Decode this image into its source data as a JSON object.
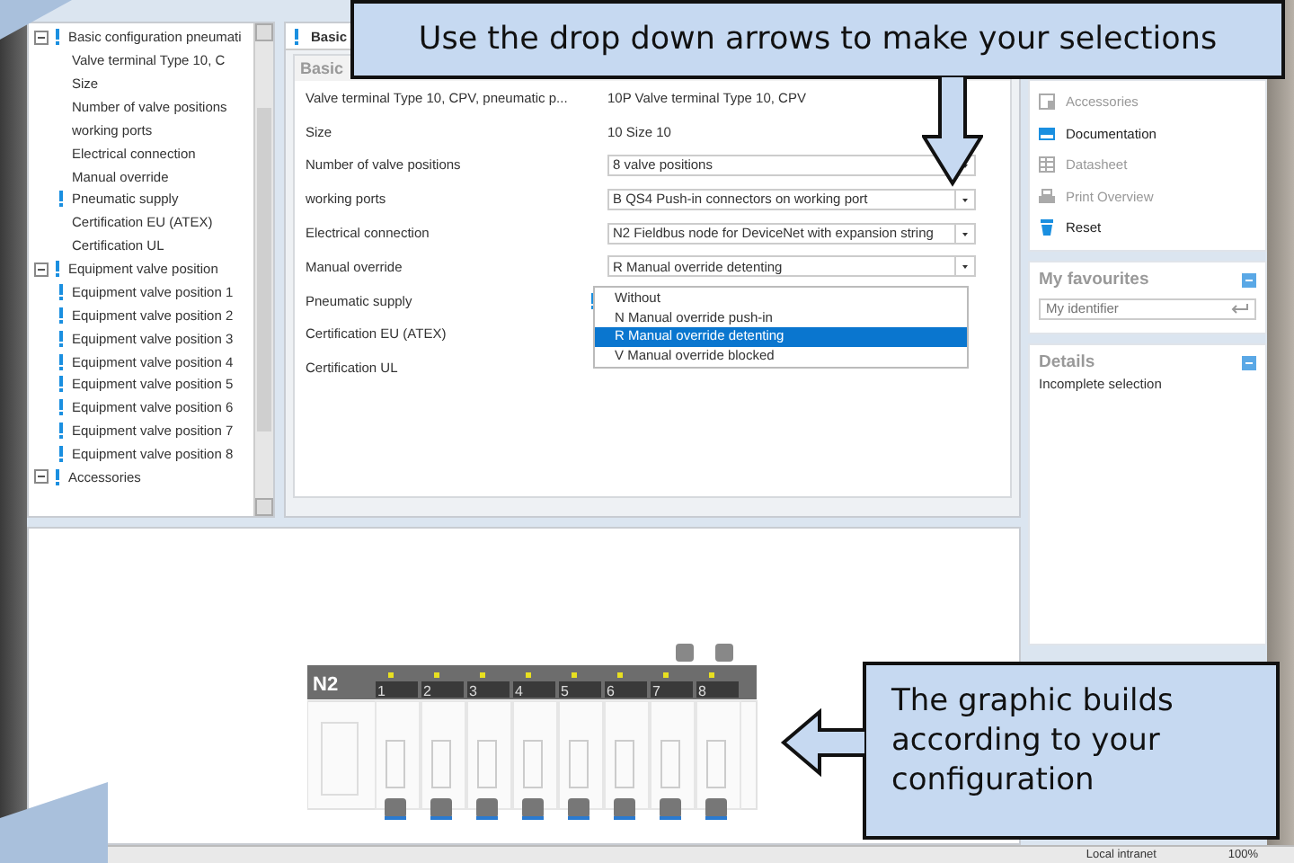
{
  "tree": [
    {
      "label": "Basic configuration pneumati",
      "required": true,
      "expanded": true,
      "children": [
        {
          "label": "Valve terminal Type 10, C",
          "required": false
        },
        {
          "label": "Size",
          "required": false
        },
        {
          "label": "Number of valve positions",
          "required": false
        },
        {
          "label": "working ports",
          "required": false
        },
        {
          "label": "Electrical connection",
          "required": false
        },
        {
          "label": "Manual override",
          "required": false
        },
        {
          "label": "Pneumatic supply",
          "required": true
        },
        {
          "label": "Certification EU (ATEX)",
          "required": false
        },
        {
          "label": "Certification UL",
          "required": false
        }
      ]
    },
    {
      "label": "Equipment valve position",
      "required": true,
      "expanded": true,
      "children": [
        {
          "label": "Equipment valve position 1",
          "required": true
        },
        {
          "label": "Equipment valve position 2",
          "required": true
        },
        {
          "label": "Equipment valve position 3",
          "required": true
        },
        {
          "label": "Equipment valve position 4",
          "required": true
        },
        {
          "label": "Equipment valve position 5",
          "required": true
        },
        {
          "label": "Equipment valve position 6",
          "required": true
        },
        {
          "label": "Equipment valve position 7",
          "required": true
        },
        {
          "label": "Equipment valve position 8",
          "required": true
        }
      ]
    },
    {
      "label": "Accessories",
      "required": true,
      "expanded": true
    }
  ],
  "main": {
    "tab": "Basic",
    "section": "Basic",
    "rows": [
      {
        "label": "Valve terminal Type 10, CPV, pneumatic p...",
        "kind": "text",
        "value": "10P Valve terminal Type 10, CPV",
        "required": false
      },
      {
        "label": "Size",
        "kind": "text",
        "value": "10 Size 10",
        "required": false
      },
      {
        "label": "Number of valve positions",
        "kind": "select",
        "value": "8 valve positions",
        "required": false
      },
      {
        "label": "working ports",
        "kind": "select",
        "value": "B QS4 Push-in connectors on working port",
        "required": false
      },
      {
        "label": "Electrical connection",
        "kind": "select",
        "value": "N2 Fieldbus node for DeviceNet with expansion string",
        "required": false
      },
      {
        "label": "Manual override",
        "kind": "select",
        "value": "R Manual override detenting",
        "required": false
      },
      {
        "label": "Pneumatic supply",
        "kind": "hidden",
        "required": true
      },
      {
        "label": "Certification EU (ATEX)",
        "kind": "hidden",
        "required": false
      },
      {
        "label": "Certification UL",
        "kind": "hidden",
        "required": false
      }
    ],
    "dropdown": [
      {
        "label": "Without",
        "selected": false
      },
      {
        "label": "N Manual override push-in",
        "selected": false
      },
      {
        "label": "R Manual override detenting",
        "selected": true
      },
      {
        "label": "V Manual override blocked",
        "selected": false
      }
    ]
  },
  "actions": [
    {
      "label": "Accessories",
      "kind": "accessories",
      "disabled": true
    },
    {
      "label": "Documentation",
      "kind": "pdf",
      "disabled": false
    },
    {
      "label": "Datasheet",
      "kind": "sheet",
      "disabled": true
    },
    {
      "label": "Print Overview",
      "kind": "print",
      "disabled": true
    },
    {
      "label": "Reset",
      "kind": "reset",
      "disabled": false
    }
  ],
  "favourites": {
    "title": "My favourites",
    "placeholder": "My identifier"
  },
  "details": {
    "title": "Details",
    "text": "Incomplete selection"
  },
  "graphic": {
    "node": "N2",
    "valves": [
      "1",
      "2",
      "3",
      "4",
      "5",
      "6",
      "7",
      "8"
    ]
  },
  "status_bar": {
    "zone": "Local intranet",
    "zoom": "100%"
  },
  "callouts": [
    {
      "text": "Use the drop down arrows to make your selections",
      "kind": "down"
    },
    {
      "text": "The graphic builds according to your configuration",
      "kind": "left"
    }
  ]
}
